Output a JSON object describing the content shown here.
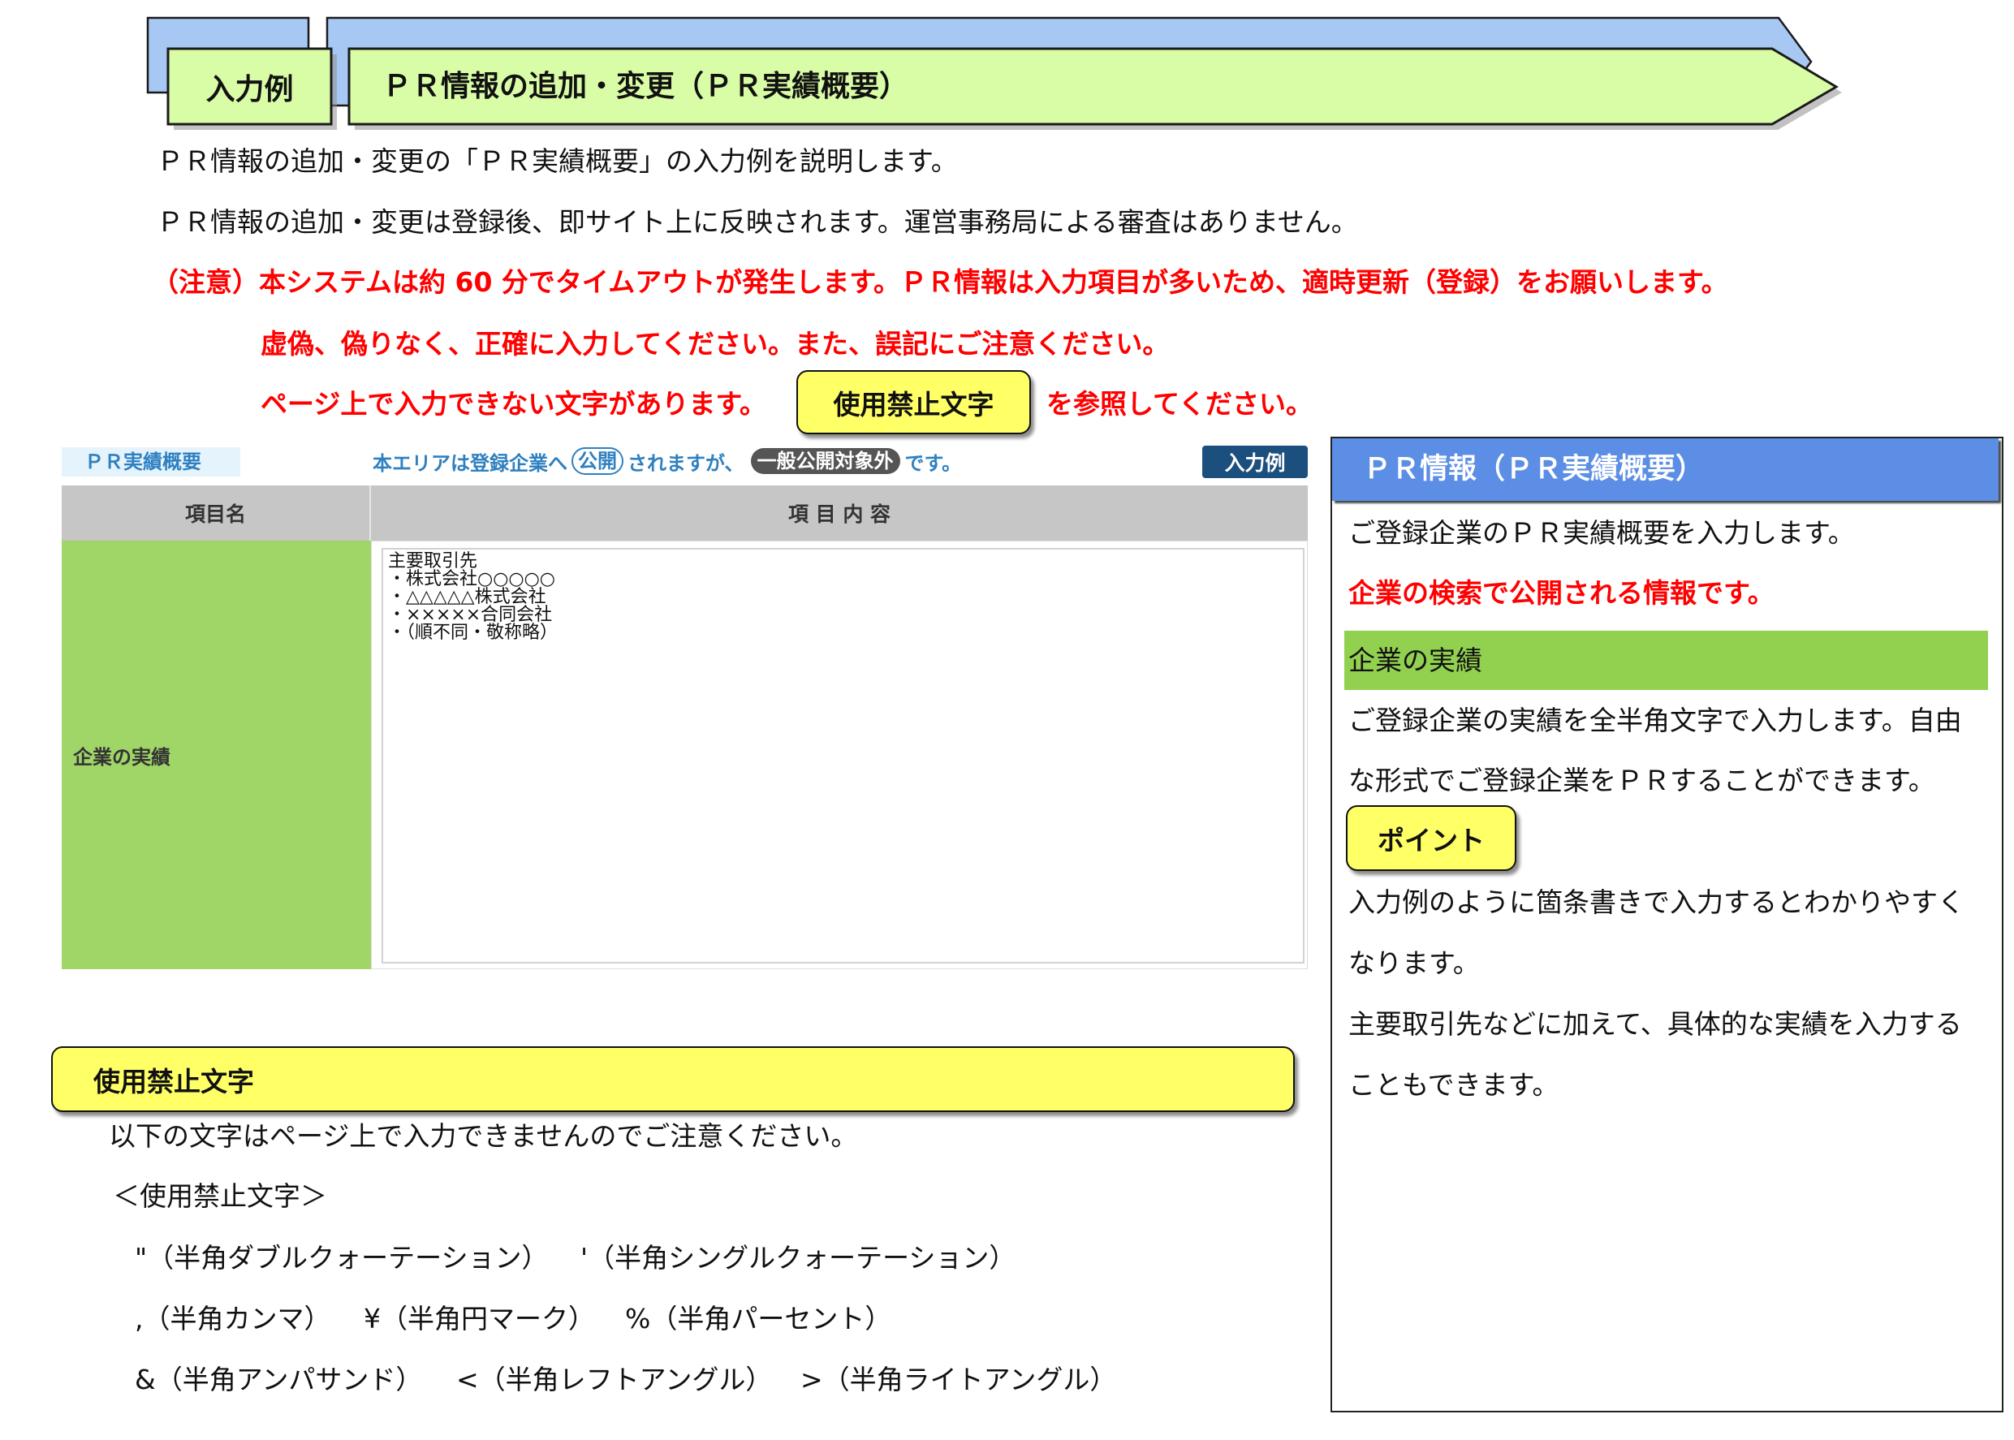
{
  "header": {
    "tab_label": "入力例",
    "title": "ＰＲ情報の追加・変更（ＰＲ実績概要）"
  },
  "intro": {
    "line1": "ＰＲ情報の追加・変更の「ＰＲ実績概要」の入力例を説明します。",
    "line2": "ＰＲ情報の追加・変更は登録後、即サイト上に反映されます。運営事務局による審査はありません。"
  },
  "notice": {
    "timeout": "（注意）本システムは約 60 分でタイムアウトが発生します。ＰＲ情報は入力項目が多いため、適時更新（登録）をお願いします。",
    "accuracy": "虚偽、偽りなく、正確に入力してください。また、誤記にご注意ください。",
    "forbidden_before": "ページ上で入力できない文字があります。",
    "forbidden_button": "使用禁止文字",
    "forbidden_after": "を参照してください。"
  },
  "form": {
    "section_label": "ＰＲ実績概要",
    "visibility": {
      "before": "本エリアは登録企業へ",
      "public_badge": "公開",
      "middle": "されますが、",
      "excluded_badge": "一般公開対象外",
      "after": "です。"
    },
    "example_button": "入力例",
    "columns": [
      "項目名",
      "項 目 内 容"
    ],
    "row": {
      "label": "企業の実績",
      "value": "主要取引先\n・株式会社○○○○○\n・△△△△△株式会社\n・×××××合同会社\n・（順不同・敬称略）"
    }
  },
  "help_panel": {
    "title": "ＰＲ情報（ＰＲ実績概要）",
    "description": "ご登録企業のＰＲ実績概要を入力します。",
    "public_note": "企業の検索で公開される情報です。",
    "item_heading": "企業の実績",
    "item_description": [
      "ご登録企業の実績を全半角文字で入力します。自由",
      "な形式でご登録企業をＰＲすることができます。"
    ],
    "point_label": "ポイント",
    "point_text": [
      "入力例のように箇条書きで入力するとわかりやすく",
      "なります。",
      "主要取引先などに加えて、具体的な実績を入力する",
      "こともできます。"
    ]
  },
  "forbidden": {
    "heading": "使用禁止文字",
    "intro": "以下の文字はページ上で入力できませんのでご注意ください。",
    "list_title": "＜使用禁止文字＞",
    "rows": [
      [
        "\"（半角ダブルクォーテーション）",
        "'（半角シングルクォーテーション）"
      ],
      [
        ",（半角カンマ）",
        "¥（半角円マーク）",
        "%（半角パーセント）"
      ],
      [
        "&（半角アンパサンド）",
        "<（半角レフトアングル）",
        ">（半角ライトアングル）"
      ]
    ]
  },
  "colors": {
    "banner_green": "#d9fda6",
    "banner_blue": "#a8c8f4",
    "warning_red": "#ff0000",
    "button_yellow": "#ffff66",
    "form_blue": "#2e80c0",
    "form_label_bg": "#e5f3fc",
    "header_gray": "#c6c6c6",
    "row_green": "#a0d568",
    "example_button_navy": "#1b4f7d",
    "badge_gray": "#555555",
    "panel_header_blue": "#5b8ee4",
    "panel_band_green": "#92d050"
  }
}
